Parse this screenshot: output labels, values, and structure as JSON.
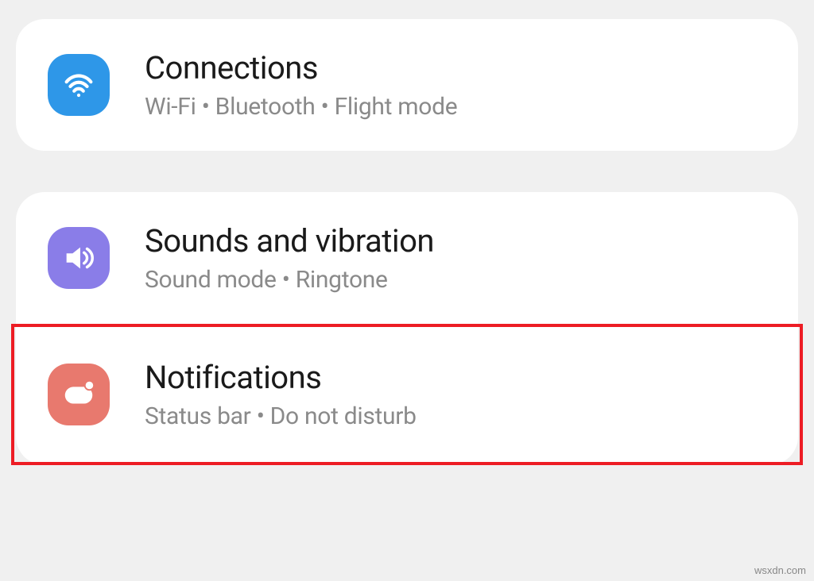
{
  "settings": {
    "connections": {
      "title": "Connections",
      "subtitle": "Wi-Fi  •  Bluetooth  •  Flight mode"
    },
    "sounds": {
      "title": "Sounds and vibration",
      "subtitle": "Sound mode  •  Ringtone"
    },
    "notifications": {
      "title": "Notifications",
      "subtitle": "Status bar  •  Do not disturb"
    }
  },
  "watermark": "wsxdn.com",
  "colors": {
    "connections_icon": "#2e97e8",
    "sounds_icon": "#8a7de8",
    "notifications_icon": "#e8796e",
    "highlight_border": "#ed1c24"
  }
}
